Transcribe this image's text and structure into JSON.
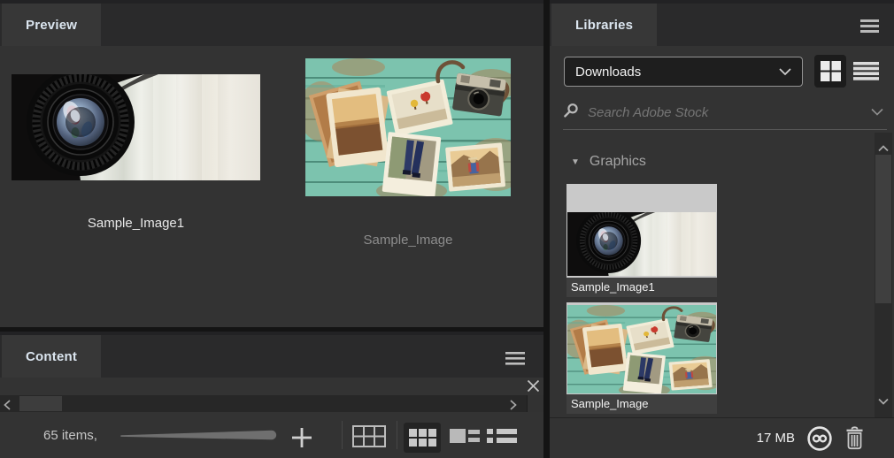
{
  "preview": {
    "tab_label": "Preview",
    "images": [
      {
        "label": "Sample_Image1",
        "selected": true
      },
      {
        "label": "Sample_Image",
        "selected": false
      }
    ]
  },
  "content": {
    "tab_label": "Content",
    "items_count": "65 items,"
  },
  "libraries": {
    "tab_label": "Libraries",
    "collection": "Downloads",
    "search": {
      "placeholder": "Search Adobe Stock"
    },
    "section": {
      "label": "Graphics"
    },
    "items": [
      {
        "label": "Sample_Image1"
      },
      {
        "label": "Sample_Image"
      }
    ],
    "storage_used": "17 MB"
  },
  "icons": {
    "triangle_down": "▼"
  },
  "colors": {
    "panel_bg": "#333333",
    "tabbar_bg": "#2a2a2b",
    "tab_active_bg": "#373737",
    "app_gap": "#161616",
    "tab_text": "#dbe5ef",
    "muted_text": "#8c8c8c",
    "thumb_card_bg": "#c9c9c9",
    "card_label_bg": "#3f3f3f"
  }
}
